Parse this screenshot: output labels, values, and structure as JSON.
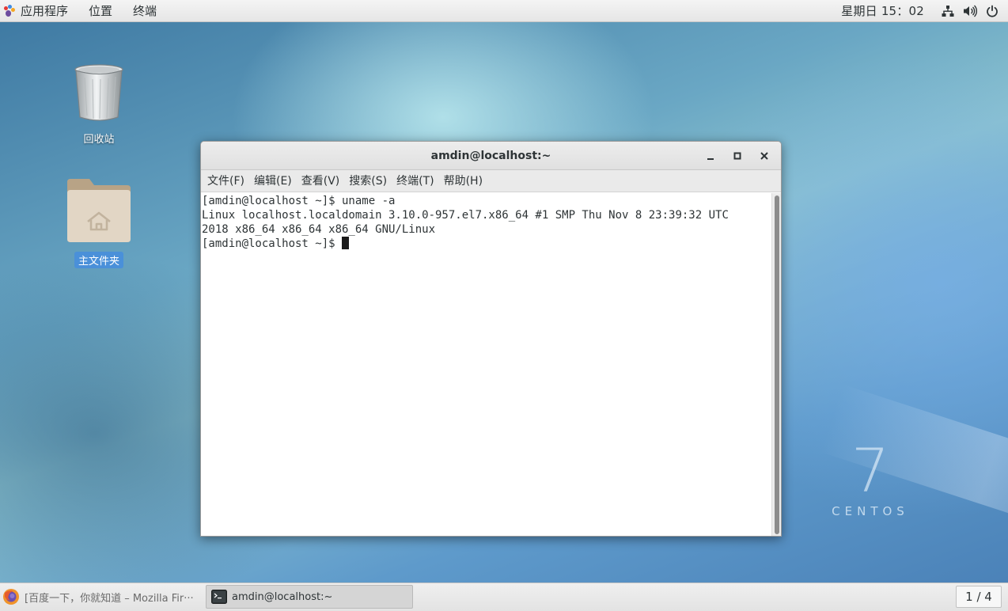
{
  "topbar": {
    "menu": [
      "应用程序",
      "位置",
      "终端"
    ],
    "clock": "星期日 15：02",
    "tray": [
      "network-icon",
      "volume-icon",
      "power-icon"
    ]
  },
  "desktop": {
    "icons": [
      {
        "label": "回收站",
        "icon": "trash-icon"
      },
      {
        "label": "主文件夹",
        "icon": "home-folder-icon",
        "selected": true
      }
    ],
    "branding": {
      "number": "7",
      "name": "CENTOS"
    }
  },
  "terminal": {
    "title": "amdin@localhost:~",
    "menu": [
      "文件(F)",
      "编辑(E)",
      "查看(V)",
      "搜索(S)",
      "终端(T)",
      "帮助(H)"
    ],
    "lines": [
      "[amdin@localhost ~]$ uname -a",
      "Linux localhost.localdomain 3.10.0-957.el7.x86_64 #1 SMP Thu Nov 8 23:39:32 UTC",
      "2018 x86_64 x86_64 x86_64 GNU/Linux"
    ],
    "prompt": "[amdin@localhost ~]$ "
  },
  "taskbar": {
    "tasks": [
      {
        "label": "[百度一下，你就知道 – Mozilla Fir···",
        "icon": "firefox-icon",
        "active": false
      },
      {
        "label": "amdin@localhost:~",
        "icon": "terminal-icon",
        "active": true
      }
    ],
    "workspace": "1 / 4"
  },
  "colors": {
    "selection": "#4a90d9",
    "topbar": "#ececec",
    "wallpaper": "#5b8fb3"
  }
}
